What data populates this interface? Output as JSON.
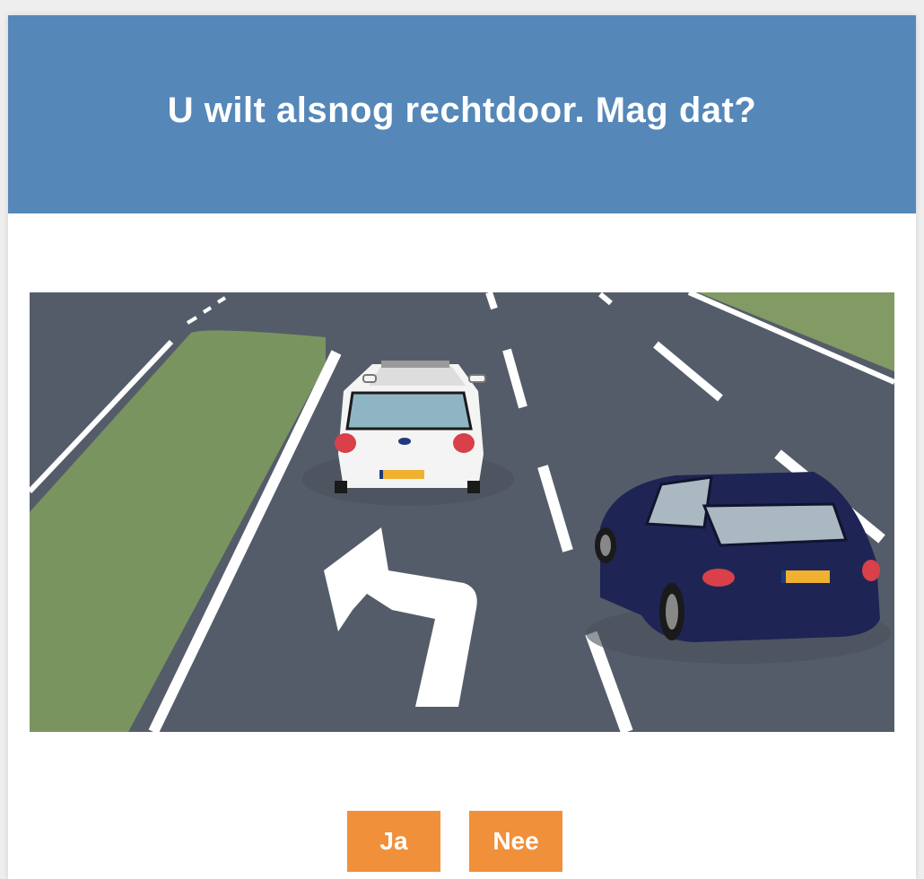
{
  "question": {
    "text": "U wilt alsnog rechtdoor. Mag dat?"
  },
  "answers": [
    {
      "label": "Ja"
    },
    {
      "label": "Nee"
    }
  ],
  "colors": {
    "header_bg": "#5587b9",
    "button_bg": "#f0903a",
    "road": "#555c69",
    "grass": "#7a9460",
    "white_car": "#f4f4f4",
    "blue_car": "#1e2554",
    "license_plate": "#f0b030"
  },
  "illustration": {
    "scene": "road-with-left-turn-arrow-white-car-and-blue-car",
    "icons": [
      "left-turn-arrow-icon"
    ]
  }
}
